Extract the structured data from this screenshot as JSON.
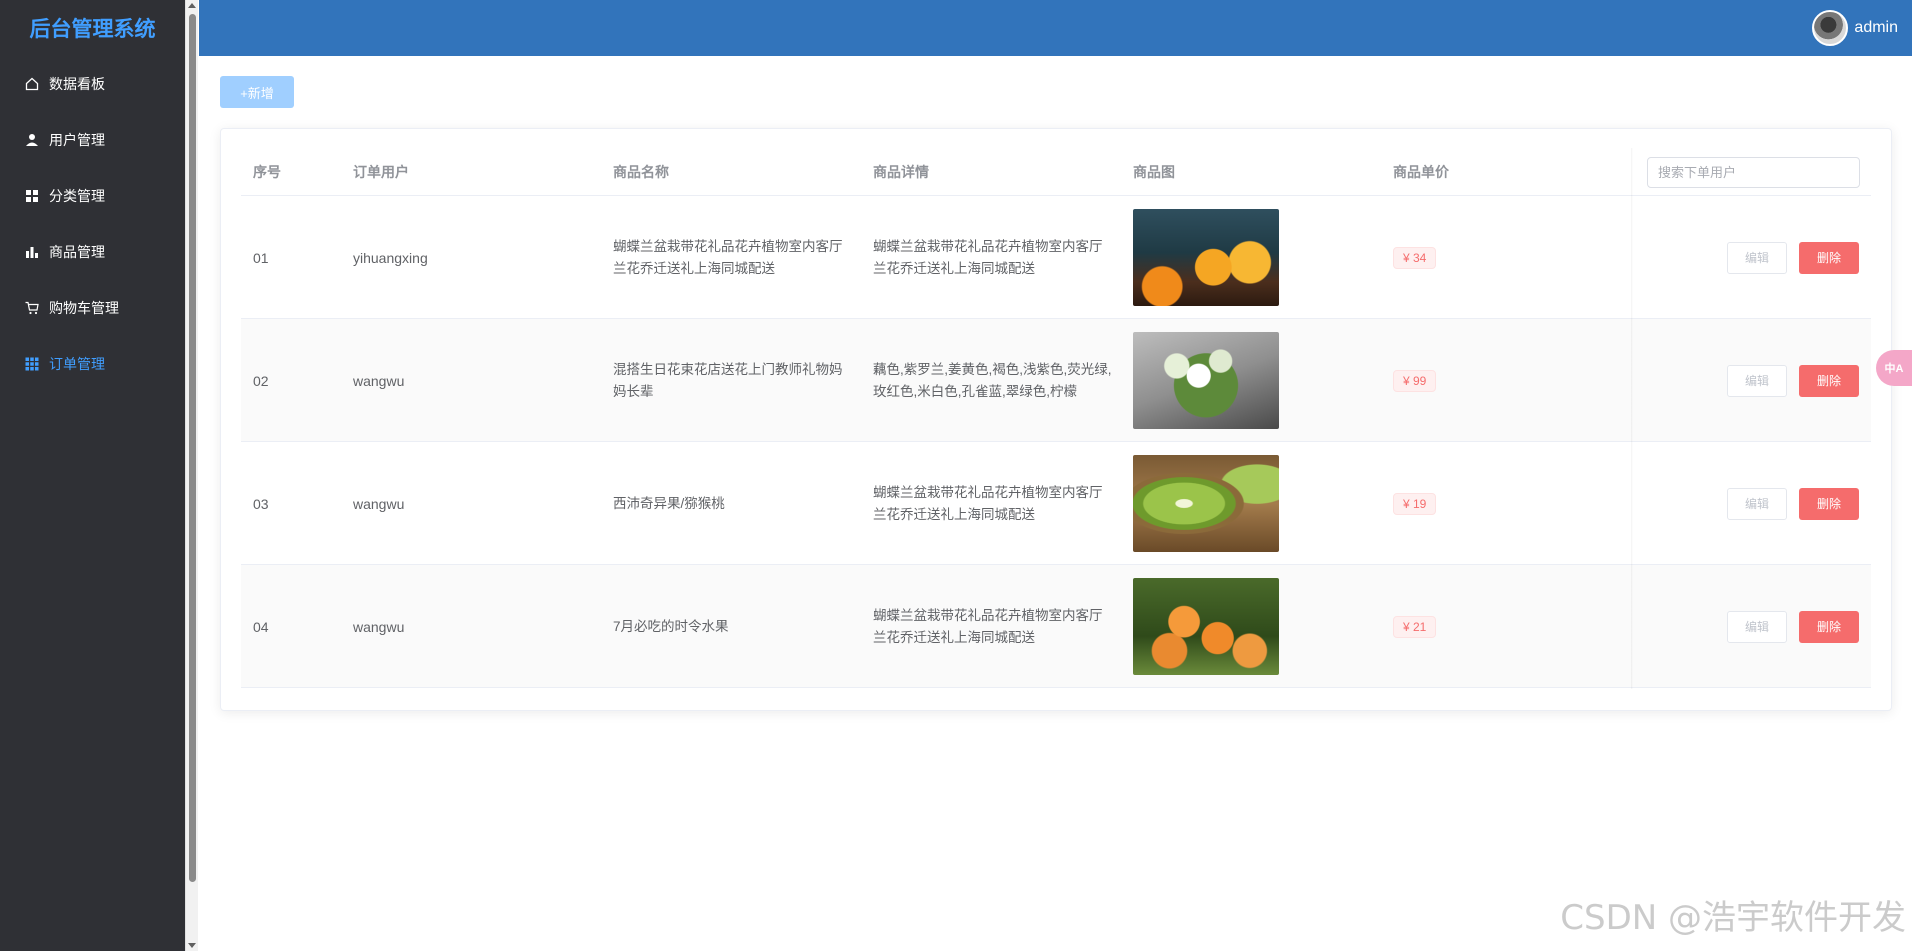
{
  "sidebar": {
    "brand": "后台管理系统",
    "items": [
      {
        "label": "数据看板",
        "icon": "home-icon"
      },
      {
        "label": "用户管理",
        "icon": "user-icon"
      },
      {
        "label": "分类管理",
        "icon": "grid-icon"
      },
      {
        "label": "商品管理",
        "icon": "bar-chart-icon"
      },
      {
        "label": "购物车管理",
        "icon": "cart-icon"
      },
      {
        "label": "订单管理",
        "icon": "apps-icon",
        "active": true
      }
    ]
  },
  "header": {
    "username": "admin"
  },
  "toolbar": {
    "add_label": "+新增"
  },
  "search": {
    "placeholder": "搜索下单用户",
    "value": ""
  },
  "table": {
    "columns": [
      "序号",
      "订单用户",
      "商品名称",
      "商品详情",
      "商品图",
      "商品单价"
    ],
    "edit_label": "编辑",
    "delete_label": "删除",
    "rows": [
      {
        "index": "01",
        "user": "yihuangxing",
        "name": "蝴蝶兰盆栽带花礼品花卉植物室内客厅兰花乔迁送礼上海同城配送",
        "detail": "蝴蝶兰盆栽带花礼品花卉植物室内客厅兰花乔迁送礼上海同城配送",
        "image": "juice",
        "price": "¥ 34"
      },
      {
        "index": "02",
        "user": "wangwu",
        "name": "混搭生日花束花店送花上门教师礼物妈妈长辈",
        "detail": "藕色,紫罗兰,姜黄色,褐色,浅紫色,荧光绿,玫红色,米白色,孔雀蓝,翠绿色,柠檬",
        "image": "flowers",
        "price": "¥ 99"
      },
      {
        "index": "03",
        "user": "wangwu",
        "name": "西沛奇异果/猕猴桃",
        "detail": "蝴蝶兰盆栽带花礼品花卉植物室内客厅兰花乔迁送礼上海同城配送",
        "image": "kiwi",
        "price": "¥ 19"
      },
      {
        "index": "04",
        "user": "wangwu",
        "name": "7月必吃的时令水果",
        "detail": "蝴蝶兰盆栽带花礼品花卉植物室内客厅兰花乔迁送礼上海同城配送",
        "image": "apricot",
        "price": "¥ 21"
      }
    ]
  },
  "floating": {
    "translate_label": "中A"
  },
  "watermark": "CSDN @浩宇软件开发",
  "colors": {
    "header": "#3274bb",
    "sidebar": "#2f3035",
    "accent": "#409eff",
    "danger": "#f56c6c"
  }
}
